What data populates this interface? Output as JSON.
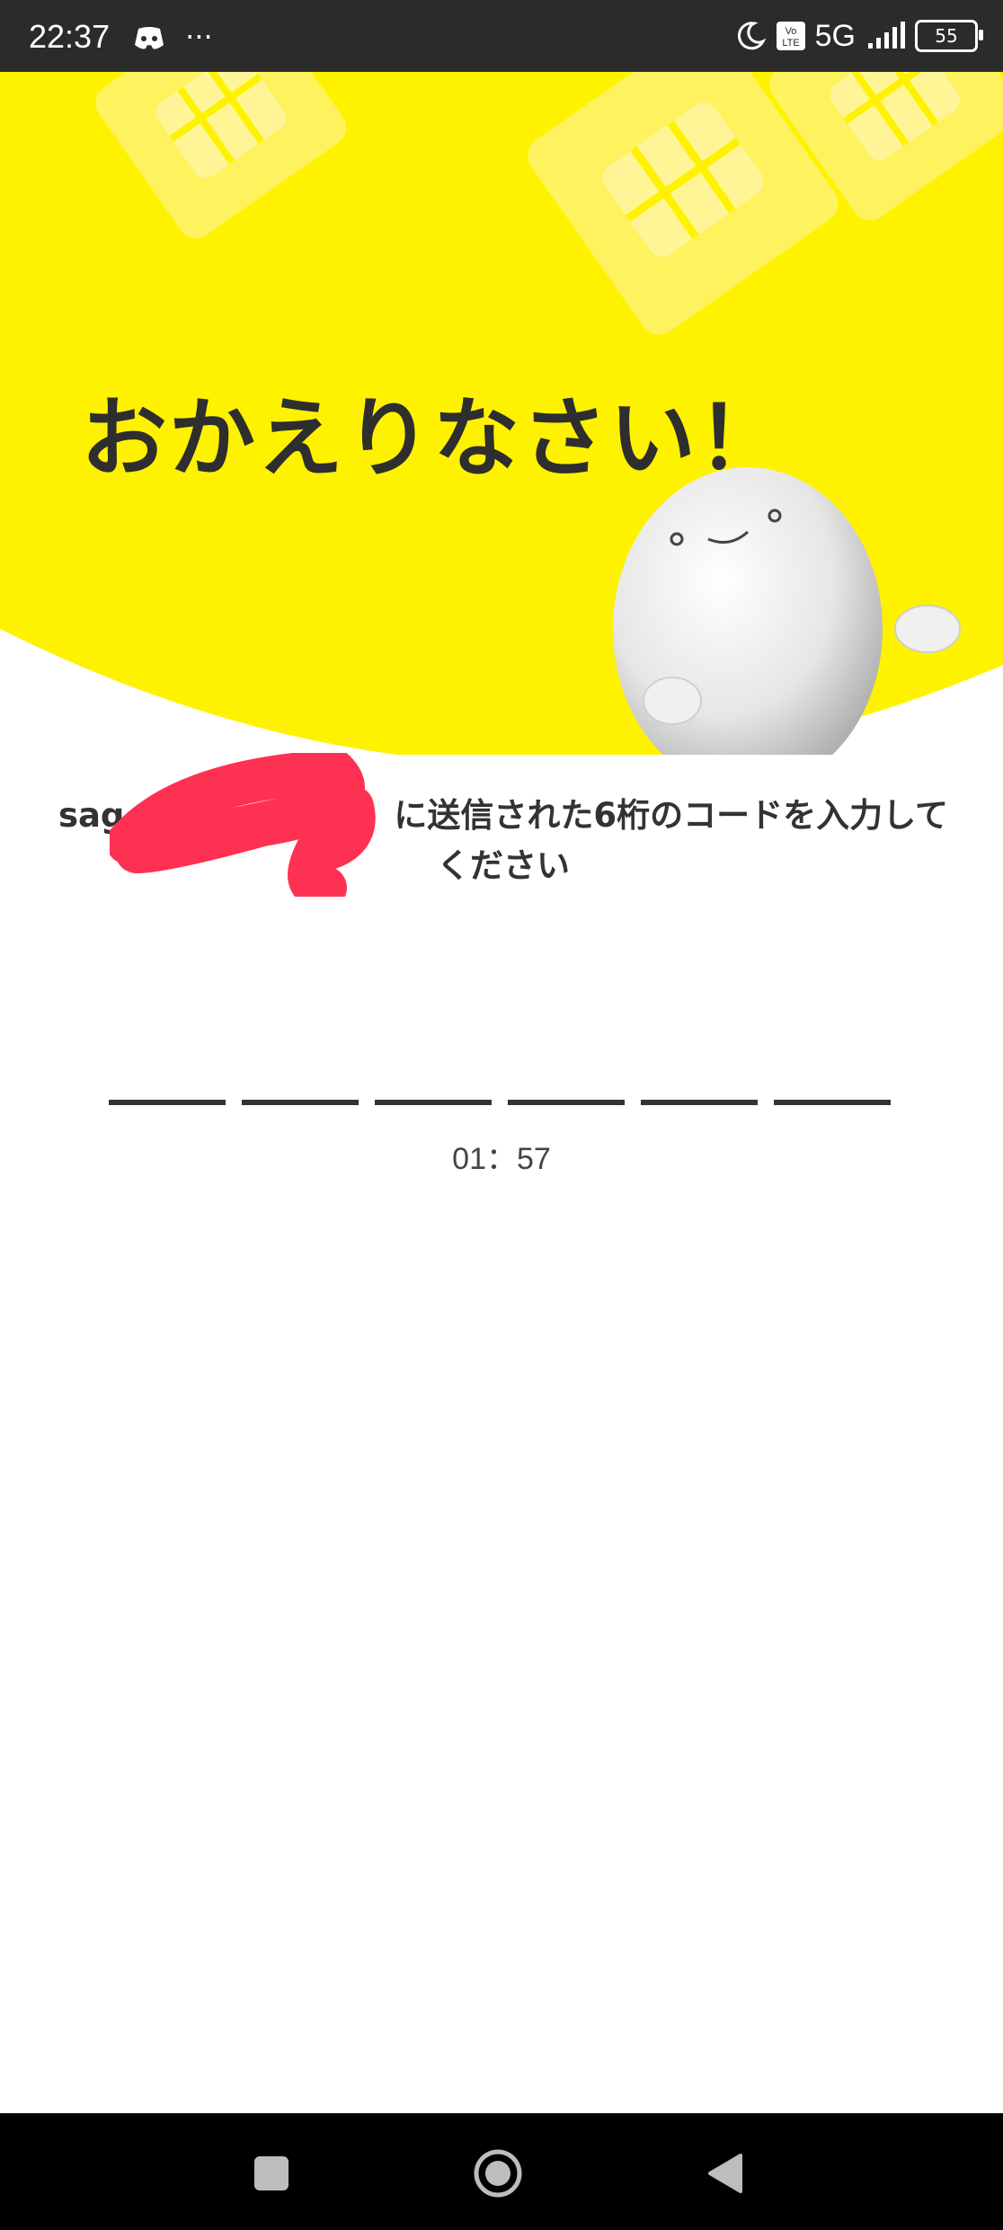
{
  "status_bar": {
    "time": "22:37",
    "left_icons": [
      "discord-icon",
      "more-dots-icon"
    ],
    "dots": "···",
    "network": "5G",
    "battery": "55",
    "right_icons": [
      "moon-icon",
      "volte-icon",
      "signal-icon",
      "battery-icon"
    ]
  },
  "hero": {
    "title": "おかえりなさい！",
    "background_color": "#FFF200"
  },
  "instruction": {
    "visible_prefix": "sag",
    "line1_suffix": "に送信された6桁のコードを入力して",
    "line2": "ください"
  },
  "code_input": {
    "slots": 6,
    "timer": "01：57"
  },
  "nav_bar": {
    "buttons": [
      "recent-apps-button",
      "home-button",
      "back-button"
    ]
  }
}
